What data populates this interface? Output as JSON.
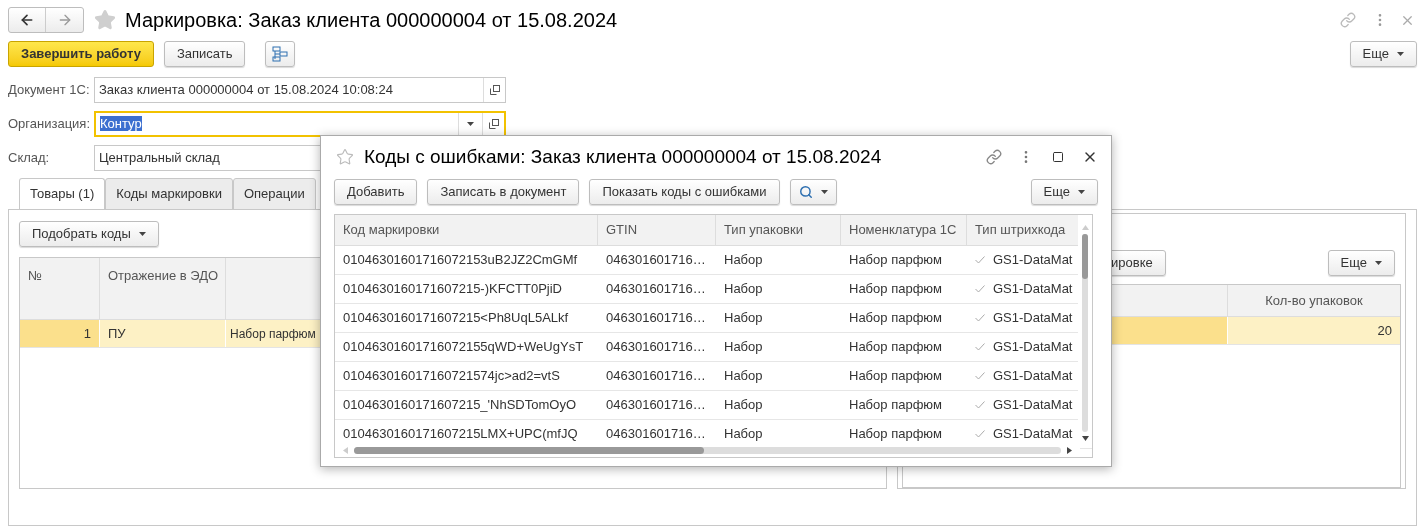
{
  "window": {
    "title": "Маркировка: Заказ клиента 000000004 от 15.08.2024"
  },
  "toolbar": {
    "buttons": [
      {
        "label": "Завершить работу",
        "kind": "primary"
      },
      {
        "label": "Записать",
        "kind": "default"
      }
    ],
    "more": "Еще"
  },
  "fields": [
    {
      "label": "Документ 1С:",
      "value": "Заказ клиента 000000004 от 15.08.2024 10:08:24",
      "kind": "link",
      "focused": false
    },
    {
      "label": "Организация:",
      "value": "Контур",
      "kind": "select",
      "focused": true
    },
    {
      "label": "Склад:",
      "value": "Центральный склад",
      "kind": "plain",
      "focused": false
    }
  ],
  "tabs": [
    {
      "label": "Товары (1)",
      "selected": true
    },
    {
      "label": "Коды маркировки",
      "selected": false
    },
    {
      "label": "Операции",
      "selected": false
    }
  ],
  "left_pane": {
    "button": "Подобрать коды",
    "table": {
      "columns": [
        "№",
        "Отражение в ЭДО"
      ],
      "rows": [
        {
          "cells": [
            "1",
            "ПУ",
            "Набор парфюм"
          ],
          "selected": true
        }
      ]
    }
  },
  "right_pane": {
    "button": "ировке",
    "more": "Еще",
    "table": {
      "columns": [
        "Кол-во упаковок"
      ],
      "rows": [
        {
          "cells": [
            "20"
          ],
          "selected": true
        }
      ]
    }
  },
  "dialog": {
    "title": "Коды с ошибками: Заказ клиента 000000004 от 15.08.2024",
    "buttons": [
      "Добавить",
      "Записать в документ",
      "Показать коды с ошибками"
    ],
    "more": "Еще",
    "table": {
      "columns": [
        "Код маркировки",
        "GTIN",
        "Тип упаковки",
        "Номенклатура 1С",
        "Тип штрихкода"
      ],
      "rows": [
        {
          "code": "01046301601716072153uB2JZ2CmGMf",
          "gtin": "046301601716…",
          "pack": "Набор",
          "item": "Набор парфюм",
          "barcode": "GS1-DataMat",
          "checked": true
        },
        {
          "code": "0104630160171607215-)KFCTT0PjiD",
          "gtin": "046301601716…",
          "pack": "Набор",
          "item": "Набор парфюм",
          "barcode": "GS1-DataMat",
          "checked": true
        },
        {
          "code": "0104630160171607215<Ph8UqL5ALkf",
          "gtin": "046301601716…",
          "pack": "Набор",
          "item": "Набор парфюм",
          "barcode": "GS1-DataMat",
          "checked": true
        },
        {
          "code": "01046301601716072155qWD+WeUgYsT",
          "gtin": "046301601716…",
          "pack": "Набор",
          "item": "Набор парфюм",
          "barcode": "GS1-DataMat",
          "checked": true
        },
        {
          "code": "010463016017160721574jc>ad2=vtS",
          "gtin": "046301601716…",
          "pack": "Набор",
          "item": "Набор парфюм",
          "barcode": "GS1-DataMat",
          "checked": true
        },
        {
          "code": "0104630160171607215_'NhSDTomOyO",
          "gtin": "046301601716…",
          "pack": "Набор",
          "item": "Набор парфюм",
          "barcode": "GS1-DataMat",
          "checked": true
        },
        {
          "code": "0104630160171607215LMX+UPC(mfJQ",
          "gtin": "046301601716…",
          "pack": "Набор",
          "item": "Набор парфюм",
          "barcode": "GS1-DataMat",
          "checked": true
        }
      ]
    }
  }
}
